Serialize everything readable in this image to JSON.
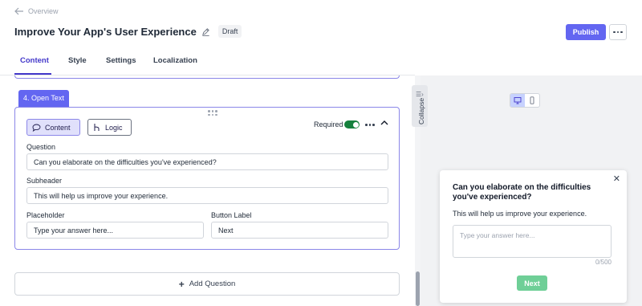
{
  "header": {
    "back_label": "Overview",
    "title": "Improve Your App's User Experience",
    "status_badge": "Draft",
    "publish_label": "Publish"
  },
  "tabs": [
    {
      "label": "Content",
      "active": true
    },
    {
      "label": "Style",
      "active": false
    },
    {
      "label": "Settings",
      "active": false
    },
    {
      "label": "Localization",
      "active": false
    }
  ],
  "question_card": {
    "tag": "4. Open Text",
    "content_btn": "Content",
    "logic_btn": "Logic",
    "required_label": "Required",
    "required_on": true,
    "question_label": "Question",
    "question_value": "Can you elaborate on the difficulties you've experienced?",
    "subheader_label": "Subheader",
    "subheader_value": "This will help us improve your experience.",
    "placeholder_label": "Placeholder",
    "placeholder_value": "Type your answer here...",
    "button_label_label": "Button Label",
    "button_label_value": "Next"
  },
  "add_question_label": "Add Question",
  "preview": {
    "collapse_label": "Collapse",
    "question": "Can you elaborate on the difficulties you've experienced?",
    "subheader": "This will help us improve your experience.",
    "input_placeholder": "Type your answer here...",
    "char_count": "0/500",
    "next_label": "Next"
  },
  "colors": {
    "accent": "#6366f1",
    "toggle_on": "#15803d",
    "next_button": "#6fcf97"
  }
}
